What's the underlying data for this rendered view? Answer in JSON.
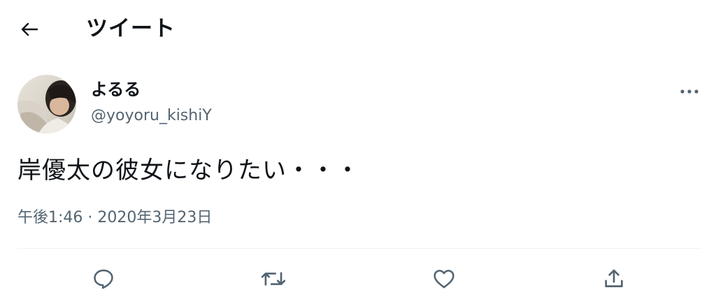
{
  "header": {
    "back_icon": "arrow-left-icon",
    "title": "ツイート"
  },
  "tweet": {
    "author": {
      "display_name": "よるる",
      "handle": "@yoyoru_kishiY",
      "avatar": "user-avatar-photo"
    },
    "more_icon": "more-horizontal-icon",
    "text": "岸優太の彼女になりたい・・・",
    "timestamp": "午後1:46 · 2020年3月23日"
  },
  "actions": [
    {
      "name": "reply",
      "icon": "reply-icon"
    },
    {
      "name": "retweet",
      "icon": "retweet-icon"
    },
    {
      "name": "like",
      "icon": "like-icon"
    },
    {
      "name": "share",
      "icon": "share-icon"
    }
  ],
  "colors": {
    "text_primary": "#0f1419",
    "text_secondary": "#536471",
    "divider": "#eff3f4",
    "icon": "#536471"
  }
}
